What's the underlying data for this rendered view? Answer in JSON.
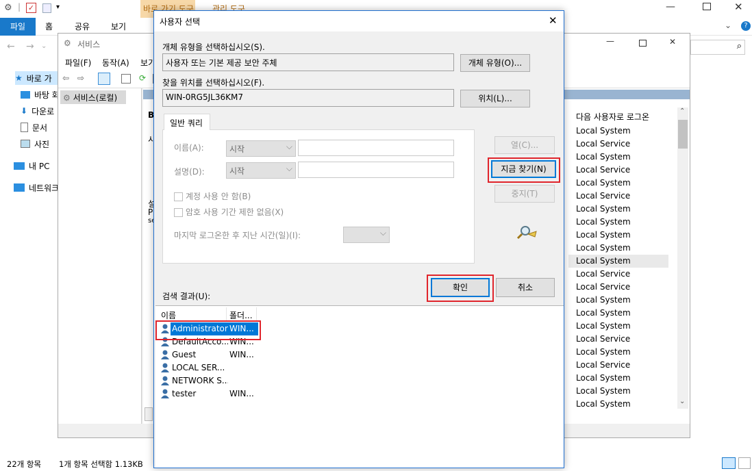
{
  "explorer": {
    "context_tab": "바로 가기 도구",
    "context_tab2": "관리 도구",
    "ribbon_tabs": [
      "파일",
      "홈",
      "공유",
      "보기"
    ],
    "nav_items": [
      "바로 가",
      "바탕 화",
      "다운로",
      "문서",
      "사진",
      "내 PC",
      "네트워크"
    ],
    "status_count": "22개 항목",
    "status_selected": "1개 항목 선택함 1.13KB"
  },
  "services": {
    "title": "서비스",
    "menu": [
      "파일(F)",
      "동작(A)",
      "보기"
    ],
    "tree_item": "서비스(로컬)",
    "pane_letter": "B",
    "pane_chars": [
      "시",
      "설",
      "P",
      "se"
    ],
    "column_header": "다음 사용자로 로그온",
    "logon_values": [
      "Local System",
      "Local Service",
      "Local System",
      "Local Service",
      "Local System",
      "Local Service",
      "Local System",
      "Local System",
      "Local System",
      "Local System",
      "Local System",
      "Local Service",
      "Local Service",
      "Local System",
      "Local System",
      "Local System",
      "Local Service",
      "Local System",
      "Local Service",
      "Local System",
      "Local System",
      "Local System"
    ],
    "selected_index": 10
  },
  "dialog": {
    "title": "사용자 선택",
    "object_type_label": "개체 유형을 선택하십시오(S).",
    "object_type_value": "사용자 또는 기본 제공 보안 주체",
    "object_type_button": "개체 유형(O)...",
    "location_label": "찾을 위치를 선택하십시오(F).",
    "location_value": "WIN-0RG5JL36KM7",
    "location_button": "위치(L)...",
    "query_tab": "일반 쿼리",
    "name_label": "이름(A):",
    "desc_label": "설명(D):",
    "combo_value": "시작",
    "check_disabled": "계정 사용 안 함(B)",
    "check_noexpire": "암호 사용 기간 제한 없음(X)",
    "lastlogon_label": "마지막 로그온한 후 지난 시간(일)(I):",
    "btn_columns": "열(C)...",
    "btn_find_now": "지금 찾기(N)",
    "btn_stop": "중지(T)",
    "btn_ok": "확인",
    "btn_cancel": "취소",
    "results_label": "검색 결과(U):",
    "results_headers": [
      "이름",
      "폴더"
    ],
    "results_header_folder_display": "폴더...",
    "results": [
      {
        "name": "Administrator",
        "folder": "WIN...",
        "selected": true
      },
      {
        "name": "DefaultAcco...",
        "folder": "WIN...",
        "selected": false
      },
      {
        "name": "Guest",
        "folder": "WIN...",
        "selected": false
      },
      {
        "name": "LOCAL SER...",
        "folder": "",
        "selected": false
      },
      {
        "name": "NETWORK S...",
        "folder": "",
        "selected": false
      },
      {
        "name": "tester",
        "folder": "WIN...",
        "selected": false
      }
    ]
  },
  "colors": {
    "accent": "#0078d7",
    "highlight_box": "#e0242b",
    "ribbon_file": "#1979ca"
  }
}
